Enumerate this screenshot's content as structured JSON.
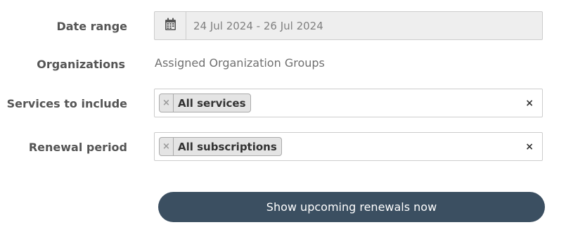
{
  "form": {
    "date_range": {
      "label": "Date range",
      "value": "24 Jul 2024 - 26 Jul 2024",
      "icon": "calendar-icon"
    },
    "organizations": {
      "label": "Organizations",
      "value": "Assigned Organization Groups"
    },
    "services": {
      "label": "Services to include",
      "tags": [
        {
          "remove": "×",
          "label": "All services"
        }
      ],
      "clear": "×"
    },
    "renewal_period": {
      "label": "Renewal period",
      "tags": [
        {
          "remove": "×",
          "label": "All subscriptions"
        }
      ],
      "clear": "×"
    },
    "submit_label": "Show upcoming renewals now"
  },
  "colors": {
    "button_bg": "#3b4f61",
    "label_text": "#555555",
    "disabled_field_bg": "#eeeeee"
  }
}
